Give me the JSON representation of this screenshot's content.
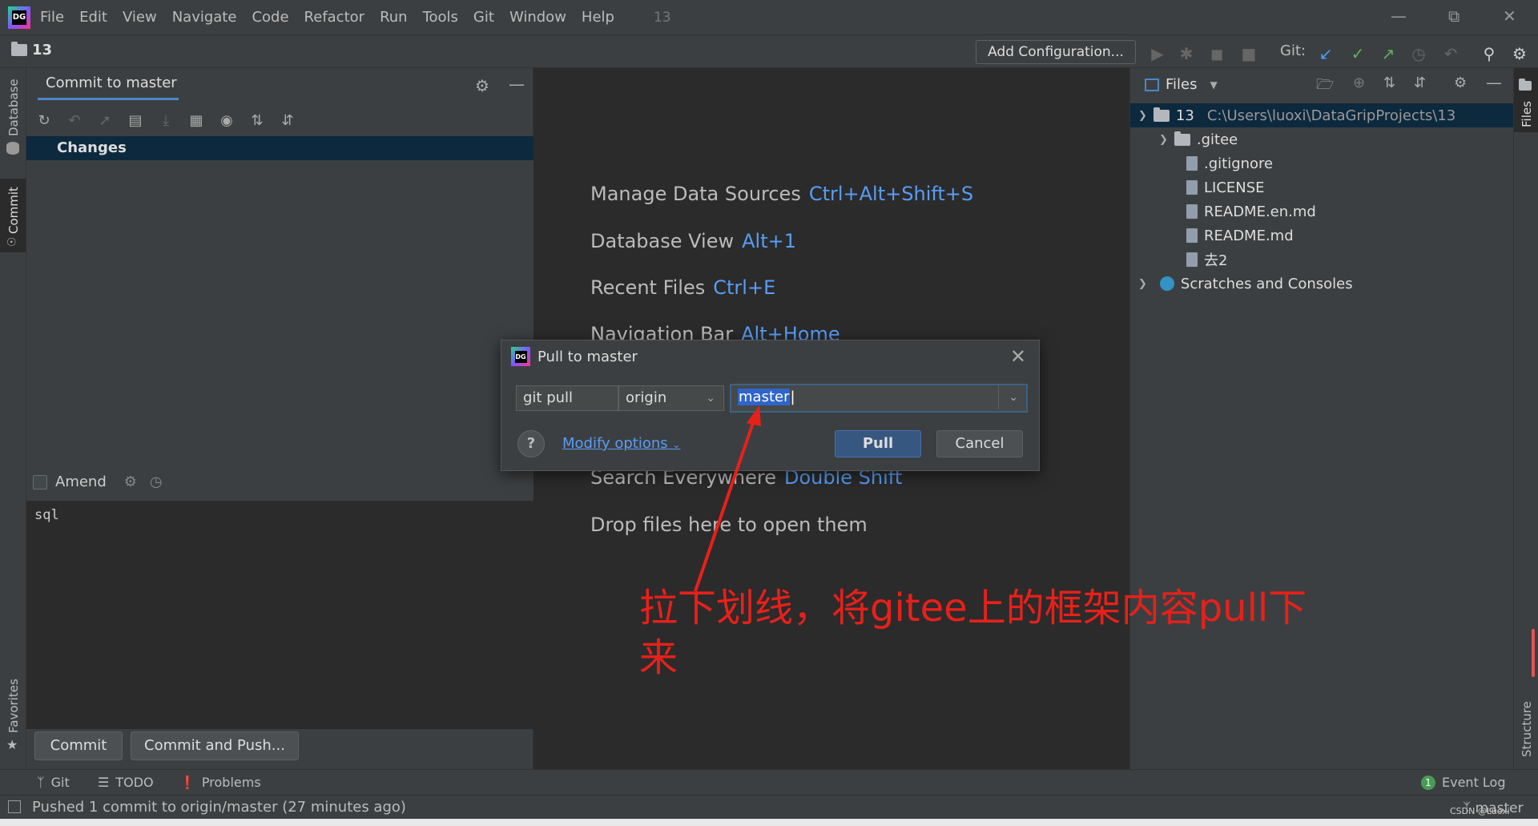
{
  "menubar": {
    "items": [
      "File",
      "Edit",
      "View",
      "Navigate",
      "Code",
      "Refactor",
      "Run",
      "Tools",
      "Git",
      "Window",
      "Help"
    ],
    "project_title": "13",
    "logo_text": "DG"
  },
  "navbar": {
    "project_name": "13",
    "add_configuration": "Add Configuration...",
    "git_label": "Git:"
  },
  "left_strip": {
    "database": "Database",
    "commit": "Commit",
    "favorites": "Favorites"
  },
  "commit_panel": {
    "tab_title": "Commit to master",
    "changes_label": "Changes",
    "amend_label": "Amend",
    "message": "sql",
    "commit_button": "Commit",
    "commit_and_push_button": "Commit and Push..."
  },
  "editor_hints": [
    {
      "label": "Manage Data Sources",
      "key": "Ctrl+Alt+Shift+S"
    },
    {
      "label": "Database View",
      "key": "Alt+1"
    },
    {
      "label": "Recent Files",
      "key": "Ctrl+E"
    },
    {
      "label": "Navigation Bar",
      "key": "Alt+Home"
    },
    {
      "label": "Search Everywhere",
      "key": "Double Shift"
    },
    {
      "label": "Drop files here to open them",
      "key": ""
    }
  ],
  "files_panel": {
    "header": "Files",
    "root_name": "13",
    "root_path": "C:\\Users\\luoxi\\DataGripProjects\\13",
    "items": [
      ".gitee",
      ".gitignore",
      "LICENSE",
      "README.en.md",
      "README.md",
      "去2"
    ],
    "scratches": "Scratches and Consoles"
  },
  "right_strip": {
    "files": "Files",
    "structure": "Structure"
  },
  "dialog": {
    "title": "Pull to master",
    "command": "git pull",
    "remote": "origin",
    "branch": "master",
    "help": "?",
    "modify_options": "Modify options",
    "pull_button": "Pull",
    "cancel_button": "Cancel"
  },
  "bottom_tools": {
    "git": "Git",
    "todo": "TODO",
    "problems": "Problems",
    "event_log": "Event Log",
    "event_count": "1"
  },
  "status": {
    "message": "Pushed 1 commit to origin/master (27 minutes ago)",
    "branch": "master",
    "watermark": "CSDN @Luoxi"
  },
  "annotation": {
    "text": "拉下划线，将gitee上的框架内容pull下来"
  },
  "colors": {
    "accent_blue": "#589df6",
    "selection": "#0d293e",
    "annotation_red": "#e8201a",
    "panel": "#3c3f41",
    "editor": "#2b2b2b"
  }
}
